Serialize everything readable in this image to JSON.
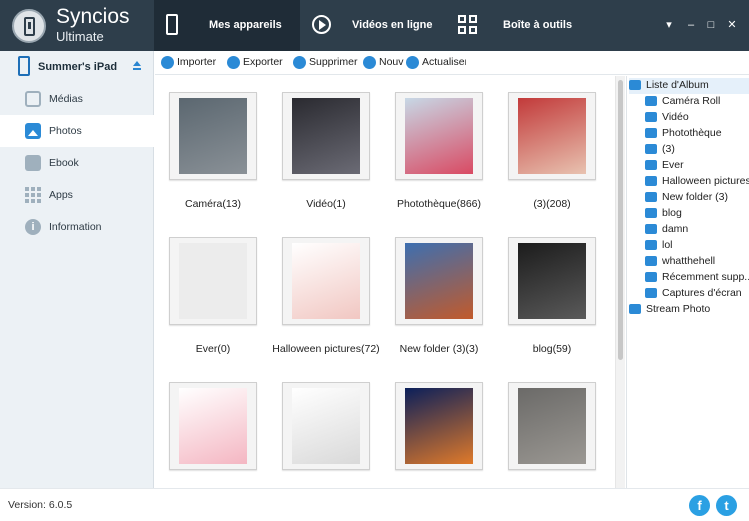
{
  "app": {
    "name": "Syncios",
    "edition": "Ultimate"
  },
  "tabs": [
    {
      "label": "Mes appareils",
      "icon": "phone-icon"
    },
    {
      "label": "Vidéos en ligne",
      "icon": "play-icon"
    },
    {
      "label": "Boîte à outils",
      "icon": "toolbox-icon"
    }
  ],
  "window_controls": {
    "menu": "▾",
    "minimize": "–",
    "maximize": "□",
    "close": "✕"
  },
  "sidebar": {
    "device": "Summer's iPad",
    "items": [
      {
        "label": "Médias",
        "icon": "tv-icon"
      },
      {
        "label": "Photos",
        "icon": "photo-icon",
        "active": true
      },
      {
        "label": "Ebook",
        "icon": "book-icon"
      },
      {
        "label": "Apps",
        "icon": "apps-icon"
      },
      {
        "label": "Information",
        "icon": "info-icon"
      }
    ]
  },
  "toolbar": {
    "import": "Importer",
    "export": "Exporter",
    "delete": "Supprimer",
    "new": "Nouv",
    "refresh": "Actualiser"
  },
  "albums": [
    {
      "caption": "Caméra(13)",
      "colors": [
        "#5b6770",
        "#8a9197"
      ]
    },
    {
      "caption": "Vidéo(1)",
      "colors": [
        "#2a2a30",
        "#6b6b75"
      ]
    },
    {
      "caption": "Photothèque(866)",
      "colors": [
        "#c7d8e6",
        "#d94a63"
      ]
    },
    {
      "caption": "(3)(208)",
      "colors": [
        "#c23a3a",
        "#e8c2b0"
      ]
    },
    {
      "caption": "Ever(0)",
      "colors": [
        "#ececec",
        "#ececec"
      ]
    },
    {
      "caption": "Halloween pictures(72)",
      "colors": [
        "#ffffff",
        "#f1c7c2"
      ]
    },
    {
      "caption": "New folder (3)(3)",
      "colors": [
        "#3d6fb0",
        "#c25a2b"
      ]
    },
    {
      "caption": "blog(59)",
      "colors": [
        "#1c1c1c",
        "#5a5a5a"
      ]
    },
    {
      "caption": "",
      "colors": [
        "#ffffff",
        "#f4b6c2"
      ]
    },
    {
      "caption": "",
      "colors": [
        "#ffffff",
        "#d9d9d9"
      ]
    },
    {
      "caption": "",
      "colors": [
        "#0b1f5a",
        "#e07a2a"
      ]
    },
    {
      "caption": "",
      "colors": [
        "#6b6a68",
        "#9b9893"
      ]
    }
  ],
  "album_tree": {
    "root": "Liste d'Album",
    "children": [
      "Caméra Roll",
      "Vidéo",
      "Photothèque",
      "(3)",
      "Ever",
      "Halloween pictures",
      "New folder (3)",
      "blog",
      "damn",
      "lol",
      "whatthehell",
      "Récemment supp...",
      "Captures d'écran"
    ],
    "stream": "Stream Photo"
  },
  "footer": {
    "version": "Version: 6.0.5",
    "facebook": "f",
    "twitter": "t"
  },
  "colors": {
    "topbar": "#2e3e4b",
    "active_tab": "#1f2c37",
    "accent": "#2b8ad6",
    "sidebar": "#ecf1f5"
  }
}
